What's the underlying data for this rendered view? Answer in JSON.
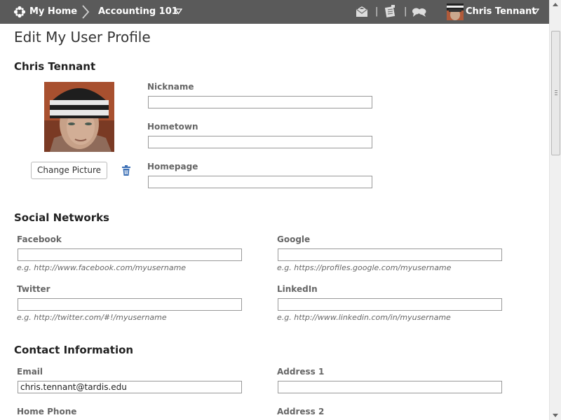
{
  "navbar": {
    "home_label": "My Home",
    "course_label": "Accounting 101",
    "user_name": "Chris Tennant",
    "separator": "|"
  },
  "page": {
    "title": "Edit My User Profile",
    "user_name": "Chris Tennant"
  },
  "profile": {
    "change_picture_label": "Change Picture",
    "nickname_label": "Nickname",
    "nickname_value": "",
    "hometown_label": "Hometown",
    "hometown_value": "",
    "homepage_label": "Homepage",
    "homepage_value": ""
  },
  "social": {
    "heading": "Social Networks",
    "facebook_label": "Facebook",
    "facebook_value": "",
    "facebook_hint": "e.g. http://www.facebook.com/myusername",
    "google_label": "Google",
    "google_value": "",
    "google_hint": "e.g. https://profiles.google.com/myusername",
    "twitter_label": "Twitter",
    "twitter_value": "",
    "twitter_hint": "e.g. http://twitter.com/#!/myusername",
    "linkedin_label": "LinkedIn",
    "linkedin_value": "",
    "linkedin_hint": "e.g. http://www.linkedin.com/in/myusername"
  },
  "contact": {
    "heading": "Contact Information",
    "email_label": "Email",
    "email_value": "chris.tennant@tardis.edu",
    "address1_label": "Address 1",
    "address1_value": "",
    "home_phone_label": "Home Phone",
    "address2_label": "Address 2"
  },
  "colors": {
    "navbar": "#5a5a5a",
    "trash_icon": "#3b6fb5"
  }
}
